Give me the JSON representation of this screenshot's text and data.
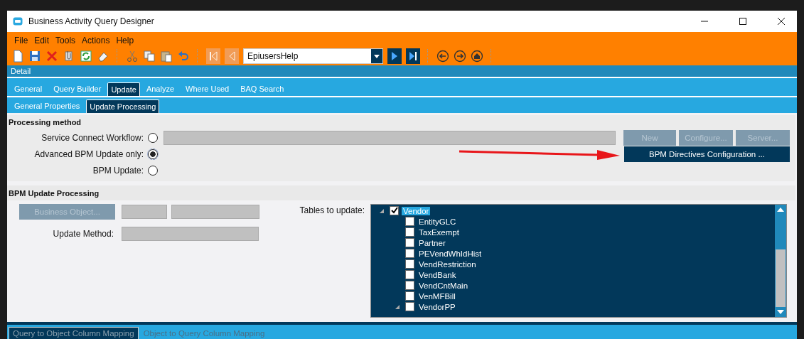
{
  "window": {
    "title": "Business Activity Query Designer"
  },
  "menu": [
    "File",
    "Edit",
    "Tools",
    "Actions",
    "Help"
  ],
  "toolbar": {
    "nav_before": [
      {
        "kind": "first",
        "disabled": true
      },
      {
        "kind": "prev",
        "disabled": true
      }
    ],
    "record": {
      "value": "EpiusersHelp"
    },
    "nav_after": [
      {
        "kind": "next",
        "disabled": false
      },
      {
        "kind": "last",
        "disabled": false
      }
    ]
  },
  "detail_bar": {
    "title": "Detail"
  },
  "tabs": [
    {
      "label": "General",
      "selected": false
    },
    {
      "label": "Query Builder",
      "selected": false
    },
    {
      "label": "Update",
      "selected": true
    },
    {
      "label": "Analyze",
      "selected": false
    },
    {
      "label": "Where Used",
      "selected": false
    },
    {
      "label": "BAQ Search",
      "selected": false
    }
  ],
  "subtabs": [
    {
      "label": "General Properties",
      "selected": false
    },
    {
      "label": "Update  Processing",
      "selected": true
    }
  ],
  "processing_method": {
    "title": "Processing method",
    "options": [
      {
        "label": "Service Connect Workflow:",
        "selected": false
      },
      {
        "label": "Advanced BPM Update only:",
        "selected": true
      },
      {
        "label": "BPM Update:",
        "selected": false
      }
    ],
    "buttons": [
      {
        "label": "New",
        "disabled": true
      },
      {
        "label": "Configure...",
        "disabled": true
      },
      {
        "label": "Server...",
        "disabled": true
      }
    ],
    "bpm_button": {
      "label": "BPM Directives Configuration ...",
      "disabled": false
    }
  },
  "bpm_update": {
    "title": "BPM Update Processing",
    "business_object_button": {
      "label": "Business Object...",
      "disabled": true
    },
    "update_method_label": "Update Method:",
    "tables_label": "Tables to update:",
    "tables": [
      {
        "label": "Vendor",
        "checked": true,
        "selected": true,
        "expanded": true,
        "children": [
          {
            "label": "EntityGLC",
            "checked": false,
            "selected": false
          },
          {
            "label": "TaxExempt",
            "checked": false,
            "selected": false
          },
          {
            "label": "Partner",
            "checked": false,
            "selected": false
          },
          {
            "label": "PEVendWhIdHist",
            "checked": false,
            "selected": false
          },
          {
            "label": "VendRestriction",
            "checked": false,
            "selected": false
          },
          {
            "label": "VendBank",
            "checked": false,
            "selected": false
          },
          {
            "label": "VendCntMain",
            "checked": false,
            "selected": false
          },
          {
            "label": "VenMFBill",
            "checked": false,
            "selected": false
          },
          {
            "label": "VendorPP",
            "checked": false,
            "selected": false,
            "expanded": true
          }
        ]
      }
    ]
  },
  "bottom_tabs": [
    {
      "label": "Query to Object Column Mapping",
      "selected": true
    },
    {
      "label": "Object to Query Column Mapping",
      "selected": false
    }
  ]
}
